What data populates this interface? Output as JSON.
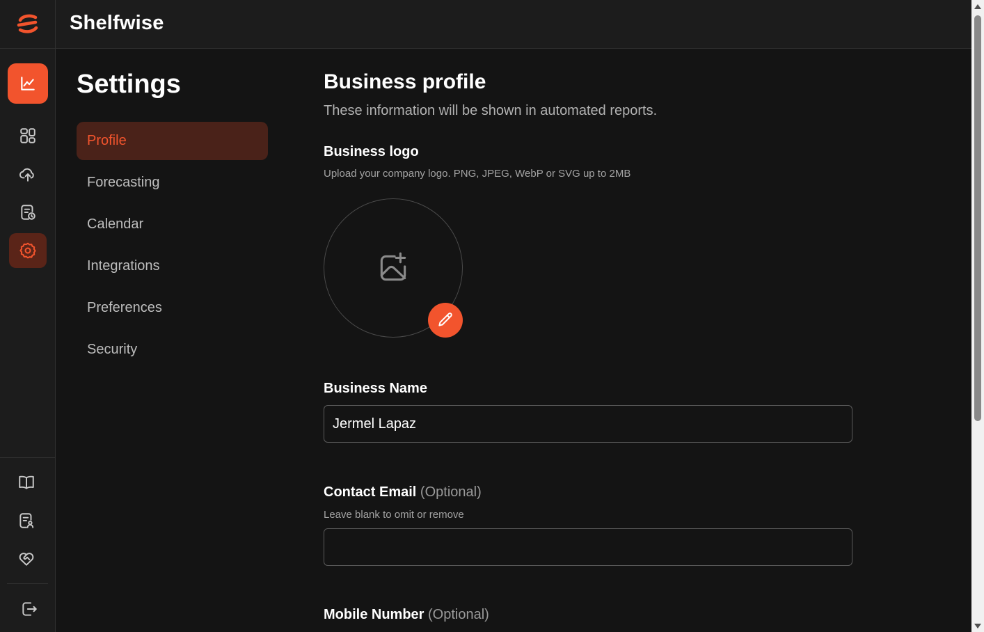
{
  "app": {
    "name": "Shelfwise"
  },
  "colors": {
    "accent": "#f2542d",
    "active_bg": "#4a2219",
    "background": "#141414",
    "panel": "#1c1c1c"
  },
  "rail": {
    "logo_icon": "shelfwise-logo-icon",
    "top_items": [
      {
        "icon": "chart-line-icon",
        "state": "primary"
      },
      {
        "icon": "dashboard-grid-icon",
        "state": "normal"
      },
      {
        "icon": "cloud-upload-icon",
        "state": "normal"
      },
      {
        "icon": "report-clock-icon",
        "state": "normal"
      },
      {
        "icon": "gear-icon",
        "state": "active"
      }
    ],
    "bottom_items": [
      {
        "icon": "book-open-icon"
      },
      {
        "icon": "document-user-icon"
      },
      {
        "icon": "heart-handshake-icon"
      }
    ],
    "logout_icon": "logout-icon"
  },
  "settings": {
    "title": "Settings",
    "nav": [
      {
        "label": "Profile",
        "active": true
      },
      {
        "label": "Forecasting",
        "active": false
      },
      {
        "label": "Calendar",
        "active": false
      },
      {
        "label": "Integrations",
        "active": false
      },
      {
        "label": "Preferences",
        "active": false
      },
      {
        "label": "Security",
        "active": false
      }
    ]
  },
  "profile": {
    "heading": "Business profile",
    "subheading": "These information will be shown in automated reports.",
    "logo": {
      "label": "Business logo",
      "hint": "Upload your company logo. PNG, JPEG, WebP or SVG up to 2MB",
      "placeholder_icon": "image-plus-icon",
      "edit_icon": "pencil-icon"
    },
    "business_name": {
      "label": "Business Name",
      "value": "Jermel Lapaz"
    },
    "contact_email": {
      "label": "Contact Email",
      "optional": "(Optional)",
      "hint": "Leave blank to omit or remove",
      "value": ""
    },
    "mobile_number": {
      "label": "Mobile Number",
      "optional": "(Optional)"
    }
  }
}
